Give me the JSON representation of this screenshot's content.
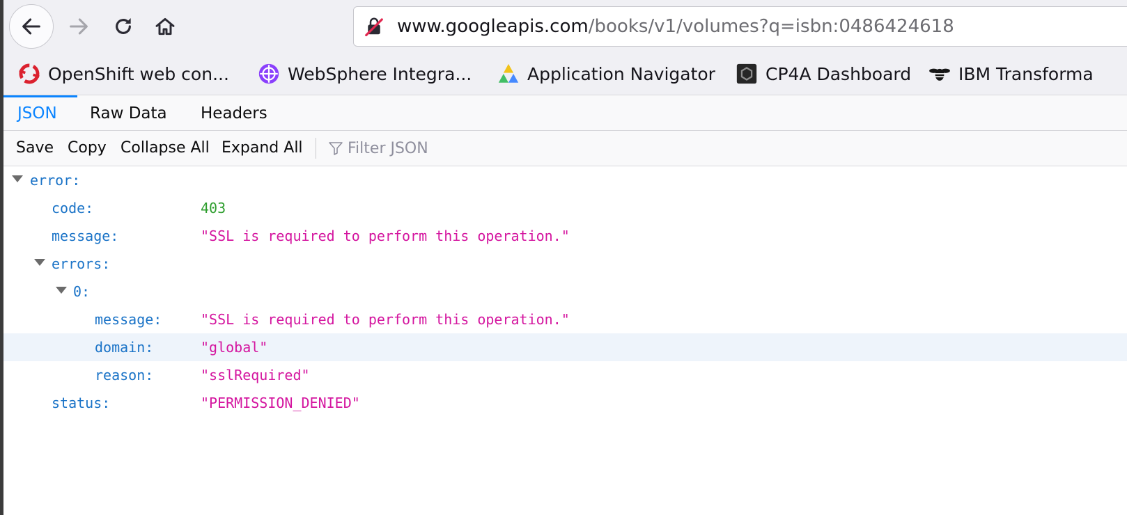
{
  "colors": {
    "json_key": "#1a73c7",
    "json_string": "#d4159f",
    "json_number": "#2e9e2e",
    "active_tab": "#0a84ff",
    "chrome_bg": "#f0f0f4"
  },
  "nav": {
    "back_icon": "arrow-left-icon",
    "forward_icon": "arrow-right-icon",
    "reload_icon": "reload-icon",
    "home_icon": "home-icon"
  },
  "url": {
    "host": "www.googleapis.com",
    "path": "/books/v1/volumes?q=isbn:0486424618",
    "security_icon": "insecure-lock-icon"
  },
  "bookmarks": [
    {
      "label": "OpenShift web con...",
      "icon": "openshift-icon"
    },
    {
      "label": "WebSphere Integra...",
      "icon": "websphere-icon"
    },
    {
      "label": "Application Navigator",
      "icon": "app-navigator-icon"
    },
    {
      "label": "CP4A Dashboard",
      "icon": "cp4a-icon"
    },
    {
      "label": "IBM Transforma",
      "icon": "ibm-bee-icon"
    }
  ],
  "viewer": {
    "tabs": [
      "JSON",
      "Raw Data",
      "Headers"
    ],
    "active_tab": "JSON",
    "toolbar": {
      "save": "Save",
      "copy": "Copy",
      "collapse_all": "Collapse All",
      "expand_all": "Expand All",
      "filter_placeholder": "Filter JSON"
    }
  },
  "json_tree": {
    "error_key": "error:",
    "code_key": "code:",
    "code_val": "403",
    "message_key": "message:",
    "message_val": "\"SSL is required to perform this operation.\"",
    "errors_key": "errors:",
    "item0_key": "0:",
    "item0_message_key": "message:",
    "item0_message_val": "\"SSL is required to perform this operation.\"",
    "item0_domain_key": "domain:",
    "item0_domain_val": "\"global\"",
    "item0_reason_key": "reason:",
    "item0_reason_val": "\"sslRequired\"",
    "status_key": "status:",
    "status_val": "\"PERMISSION_DENIED\""
  }
}
